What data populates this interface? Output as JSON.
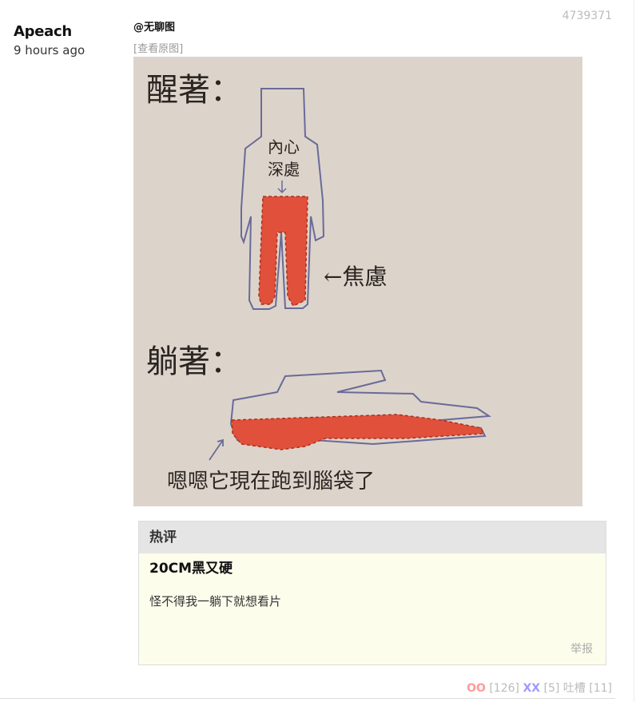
{
  "post": {
    "author": "Apeach",
    "time_ago": "9 hours ago",
    "id": "4739371",
    "mention": "@无聊图",
    "view_original": "[查看原图]"
  },
  "meme": {
    "top_label": "醒著：",
    "inner_label_line1": "內心",
    "inner_label_line2": "深處",
    "anxiety_label": "←焦慮",
    "bottom_label": "躺著：",
    "caption": "嗯嗯它現在跑到腦袋了",
    "colors": {
      "background": "#dcd4ca",
      "outline": "#6a6a9a",
      "fill": "#e0503a"
    }
  },
  "hot_comment": {
    "header": "热评",
    "user": "20CM黑又硬",
    "text": "怪不得我一躺下就想看片",
    "report": "举报"
  },
  "votes": {
    "oo_label": "OO",
    "oo_count": "[126]",
    "xx_label": "XX",
    "xx_count": "[5]",
    "tucao_label": "吐槽",
    "tucao_count": "[11]"
  }
}
